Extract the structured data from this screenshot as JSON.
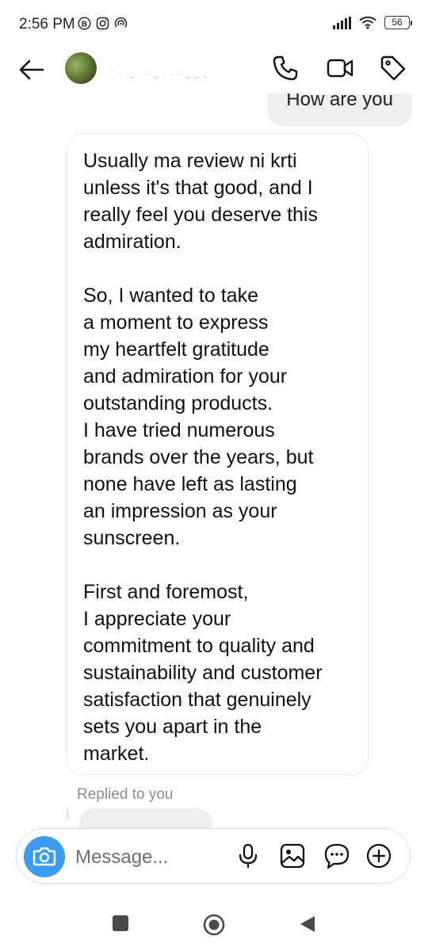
{
  "status_bar": {
    "time": "2:56 PM",
    "battery": "56",
    "left_icons": [
      "b-circle-icon",
      "instagram-icon",
      "hotspot-icon"
    ],
    "right_icons": [
      "signal-icon",
      "wifi-icon",
      "battery-icon"
    ]
  },
  "header": {
    "username": "´ · ·_ · · _ · · · _ _ ¸",
    "icons": [
      "back-arrow-icon",
      "phone-icon",
      "video-icon",
      "tag-icon"
    ]
  },
  "messages": {
    "outgoing_partial": "How are you",
    "incoming_paragraphs": [
      "Usually ma review ni krti\nunless it's that good, and I\nreally feel you deserve this\nadmiration.",
      "So, I wanted to take\na moment to express\nmy heartfelt gratitude\nand admiration for your\noutstanding products.\nI have tried numerous\nbrands over the years, but\nnone have left as lasting\nan impression as your\nsunscreen.",
      "First and foremost,\nI appreciate your\ncommitment to quality and\nsustainability and customer\nsatisfaction that genuinely\nsets you apart in the\nmarket."
    ],
    "replied_label": "Replied to you"
  },
  "composer": {
    "placeholder": "Message...",
    "icons": [
      "camera-icon",
      "microphone-icon",
      "gallery-icon",
      "sticker-icon",
      "add-icon"
    ],
    "accent": "#3b9af2"
  },
  "nav_bar": {
    "icons": [
      "recents-icon",
      "home-icon",
      "back-icon"
    ]
  }
}
